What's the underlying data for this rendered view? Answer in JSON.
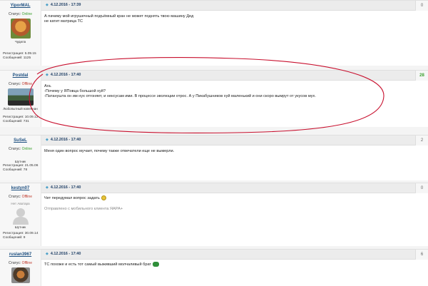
{
  "labels": {
    "status": "Статус:",
    "online": "Online",
    "offline": "Offline",
    "registration": "Регистрация:",
    "messages": "Сообщений:"
  },
  "posts": [
    {
      "username": "YiporMAL",
      "status": "online",
      "caption": "Чудила",
      "registration": "5.09.15",
      "messages": "1125",
      "date": "4.12.2016 - 17:39",
      "vote": "0",
      "lines": [
        "А пачиму мой игрушечный подъёмный кран не может поднять твою машину Дед",
        "не катит матрица ТС"
      ]
    },
    {
      "username": "Postdal",
      "status": "offline",
      "caption": "Любопытный напеннан",
      "registration": "10.09.12",
      "messages": "731",
      "date": "4.12.2016 - 17:40",
      "vote": "28",
      "lines": [
        "Ага.",
        "-Почему у ЯПовца большой хуй?",
        "-Патанушта он им нух отгоняет, и нексусам ими. В процессе эволюции отрос. А у Пикабушников хуй маленький и они скоро вымрут от укусов мух."
      ]
    },
    {
      "username": "SuSeL",
      "status": "online",
      "caption": "Шутник",
      "registration": "21.05.06",
      "messages": "78",
      "date": "4.12.2016 - 17:40",
      "vote": "2",
      "lines": [
        "Меня один вопрос мучает, почему также отвечатели еще не вымерли."
      ]
    },
    {
      "username": "kestyn07",
      "status": "offline",
      "avatar_text": "Нет Аватара",
      "caption": "Шутник",
      "registration": "30.09.14",
      "messages": "9",
      "date": "4.12.2016 - 17:40",
      "vote": "0",
      "lines": [
        "Чет передумал вопрос задать"
      ],
      "mobile": "Отправлено с мобильного клиента ЯАРА+"
    },
    {
      "username": "ruslan3967",
      "status": "offline",
      "date": "4.12.2016 - 17:40",
      "vote": "6",
      "lines": [
        "ТС похоже и есть тот самый выживший молчаливый брат"
      ]
    }
  ]
}
